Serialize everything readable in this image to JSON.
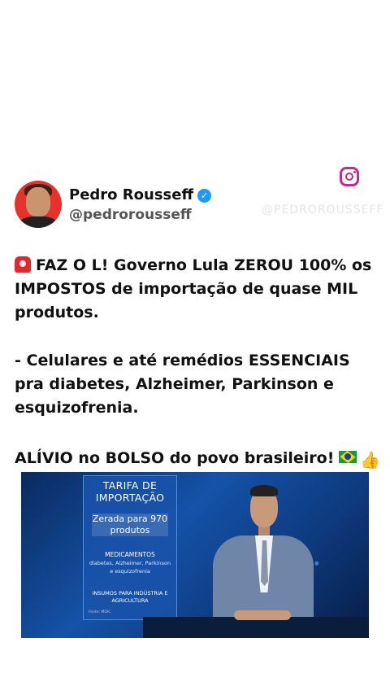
{
  "profile": {
    "name": "Pedro Rousseff",
    "handle": "@pedrorousseff",
    "verified_icon": "verified-badge-icon",
    "avatar_bg_color": "#e8302c"
  },
  "watermark": "@PEDROROUSSEFF",
  "instagram_icon": "instagram-icon",
  "tweet": {
    "line1": "FAZ O L! Governo Lula ZEROU 100% os IMPOSTOS de importação de quase MIL produtos.",
    "line2": "- Celulares e até remédios ESSENCIAIS pra diabetes, Alzheimer, Parkinson e esquizofrenia.",
    "line3": "ALÍVIO no BOLSO do povo brasileiro!",
    "emoji_start": "siren-icon",
    "emoji_end": [
      "brazil-flag-icon",
      "thumbs-up-icon"
    ]
  },
  "news_graphic": {
    "title": "TARIFA DE IMPORTAÇÃO",
    "zeroed": "Zerada para 970 produtos",
    "meds_title": "MEDICAMENTOS",
    "meds_sub": "diabetes, Alzheimer, Parkinson e esquizofrenia",
    "inputs": "INSUMOS PARA INDÚSTRIA E AGRICULTURA",
    "footer": "Fonte: MDIC"
  }
}
